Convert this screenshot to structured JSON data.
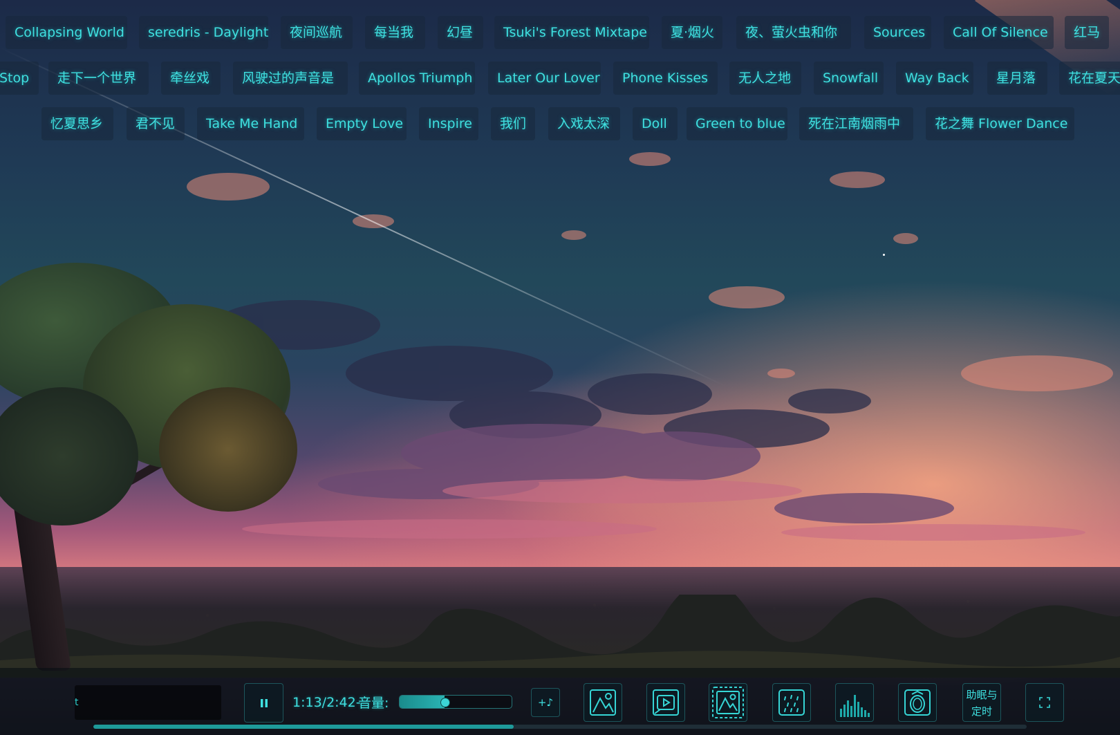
{
  "songs": {
    "row1": [
      "Collapsing World",
      "seredris - Daylight",
      "夜间巡航",
      "每当我",
      "幻昼",
      "Tsuki's Forest Mixtape",
      "夏·烟火",
      "夜、萤火虫和你",
      "Sources",
      "Call Of Silence",
      "红马"
    ],
    "row2": [
      "Stop",
      "走下一个世界",
      "牵丝戏",
      "风驶过的声音是",
      "Apollos Triumph",
      "Later Our Lover",
      "Phone Kisses",
      "无人之地",
      "Snowfall",
      "Way Back",
      "星月落",
      "花在夏天"
    ],
    "row3": [
      "忆夏思乡",
      "君不见",
      "Take Me Hand",
      "Empty Love",
      "Inspire",
      "我们",
      "入戏太深",
      "Doll",
      "Green to blue",
      "死在江南烟雨中",
      "花之舞 Flower Dance"
    ]
  },
  "player": {
    "lyric_text": "t",
    "time": "1:13/2:42",
    "separator": "-",
    "volume_label": "音量:",
    "volume_level": 0.4,
    "progress_fraction": 0.45,
    "add_song_label": "+♪",
    "sleep_label_line1": "助眠与",
    "sleep_label_line2": "定时"
  },
  "icons": {
    "play_pause": "pause-icon",
    "add": "add-music-icon",
    "tools": [
      "image-icon",
      "video-icon",
      "image-frame-icon",
      "rain-icon",
      "spectrum-icon",
      "meditation-icon"
    ],
    "fullscreen": "fullscreen-icon"
  },
  "colors": {
    "accent": "#3fe0e0",
    "accent_dark": "#1e9a9a"
  }
}
